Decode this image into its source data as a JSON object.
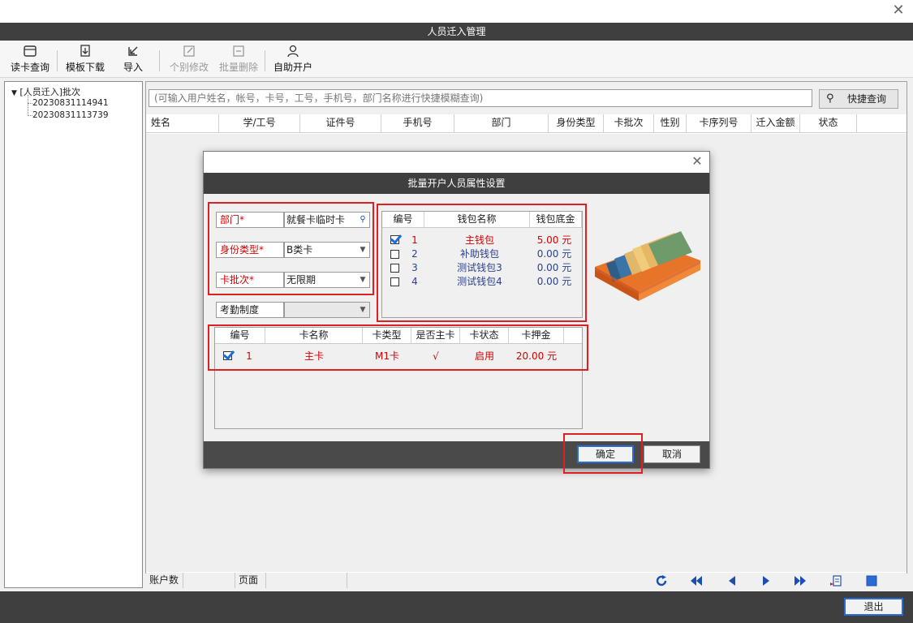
{
  "window": {
    "title": "人员迁入管理",
    "close": "✕"
  },
  "toolbar": {
    "read_card": "读卡查询",
    "template_download": "模板下载",
    "import": "导入",
    "modify_single": "个别修改",
    "batch_delete": "批量删除",
    "self_open": "自助开户"
  },
  "tree": {
    "root": "[人员迁入]批次",
    "children": [
      "20230831114941",
      "20230831113739"
    ]
  },
  "search": {
    "placeholder": "(可输入用户姓名，帐号，卡号，工号，手机号，部门名称进行快捷模糊查询)",
    "button": "快捷查询"
  },
  "grid": {
    "columns": [
      "姓名",
      "学/工号",
      "证件号",
      "手机号",
      "部门",
      "身份类型",
      "卡批次",
      "性别",
      "卡序列号",
      "迁入金额",
      "状态"
    ]
  },
  "statusbar": {
    "accounts": "账户数",
    "page": "页面"
  },
  "exit": "退出",
  "dialog": {
    "title": "批量开户人员属性设置",
    "close": "✕",
    "fields": {
      "dept_label": "部门*",
      "dept_value": "就餐卡临时卡",
      "identity_label": "身份类型*",
      "identity_value": "B类卡",
      "batch_label": "卡批次*",
      "batch_value": "无限期",
      "attendance_label": "考勤制度",
      "attendance_value": ""
    },
    "wallet_table": {
      "headers": [
        "编号",
        "钱包名称",
        "钱包底金"
      ],
      "rows": [
        {
          "no": "1",
          "name": "主钱包",
          "amount": "5.00 元",
          "checked": true
        },
        {
          "no": "2",
          "name": "补助钱包",
          "amount": "0.00 元",
          "checked": false
        },
        {
          "no": "3",
          "name": "测试钱包3",
          "amount": "0.00 元",
          "checked": false
        },
        {
          "no": "4",
          "name": "测试钱包4",
          "amount": "0.00 元",
          "checked": false
        }
      ]
    },
    "card_table": {
      "headers": [
        "编号",
        "卡名称",
        "卡类型",
        "是否主卡",
        "卡状态",
        "卡押金"
      ],
      "rows": [
        {
          "no": "1",
          "name": "主卡",
          "type": "M1卡",
          "main": "√",
          "status": "启用",
          "deposit": "20.00 元",
          "checked": true
        }
      ]
    },
    "ok": "确定",
    "cancel": "取消"
  }
}
